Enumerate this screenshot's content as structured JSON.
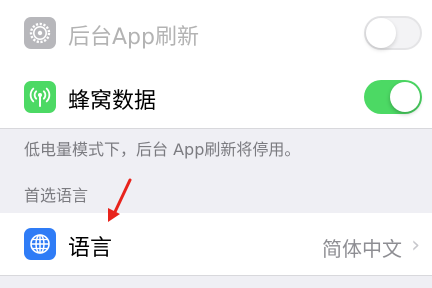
{
  "settings": {
    "background_refresh": {
      "label": "后台App刷新",
      "icon": "gear-icon",
      "enabled": false
    },
    "cellular_data": {
      "label": "蜂窝数据",
      "icon": "antenna-icon",
      "enabled": true
    },
    "footnote": "低电量模式下，后台 App刷新将停用。",
    "preferred_language_section": {
      "header": "首选语言",
      "row": {
        "label": "语言",
        "value": "简体中文",
        "icon": "globe-icon"
      }
    }
  },
  "colors": {
    "accent_green": "#4cd964",
    "language_blue": "#2f7cf6",
    "annotation_red": "#e8231c"
  }
}
